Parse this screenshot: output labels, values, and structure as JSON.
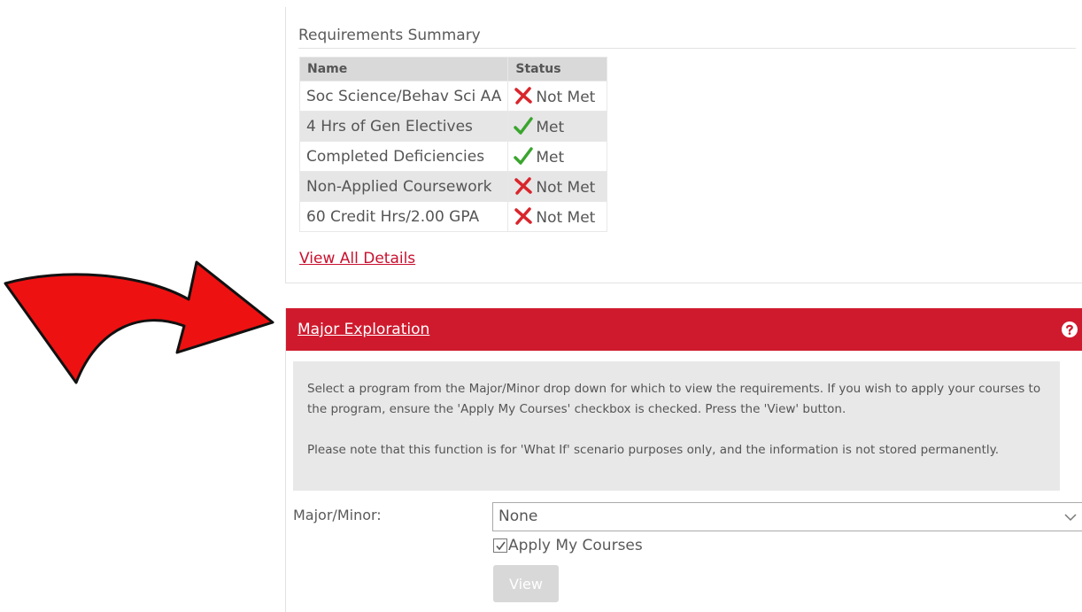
{
  "requirements": {
    "title": "Requirements Summary",
    "columns": [
      "Name",
      "Status"
    ],
    "rows": [
      {
        "name": "Soc Science/Behav Sci AA",
        "status": "Not Met",
        "icon": "x-icon"
      },
      {
        "name": "4 Hrs of Gen Electives",
        "status": "Met",
        "icon": "check-icon"
      },
      {
        "name": "Completed Deficiencies",
        "status": "Met",
        "icon": "check-icon"
      },
      {
        "name": "Non-Applied Coursework",
        "status": "Not Met",
        "icon": "x-icon"
      },
      {
        "name": "60 Credit Hrs/2.00 GPA",
        "status": "Not Met",
        "icon": "x-icon"
      }
    ],
    "view_all_label": "View All Details"
  },
  "major_exploration": {
    "title": "Major Exploration",
    "help_icon": "question-circle-icon",
    "info_paragraph_1": "Select a program from the Major/Minor drop down for which to view the requirements. If you wish to apply your courses to the program, ensure the 'Apply My Courses' checkbox is checked. Press the 'View' button.",
    "info_paragraph_2": "Please note that this function is for 'What If' scenario purposes only, and the information is not stored permanently.",
    "major_minor_label": "Major/Minor:",
    "major_minor_selected": "None",
    "apply_courses_label": "Apply My Courses",
    "apply_courses_checked": true,
    "view_button_label": "View"
  },
  "colors": {
    "accent_red": "#cf1a2e",
    "link_red": "#c8102e",
    "met_green": "#3aa52e",
    "not_met_red": "#d9252b",
    "arrow_red": "#ee1111"
  }
}
